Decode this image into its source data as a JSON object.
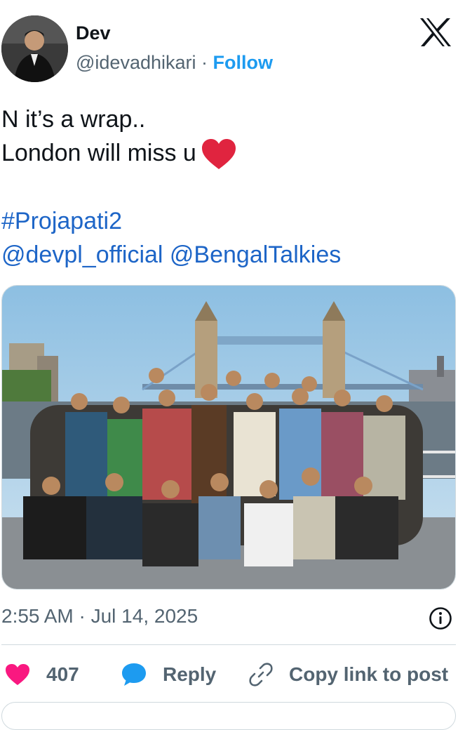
{
  "author": {
    "name": "Dev",
    "handle": "@idevadhikari",
    "separator": "·",
    "follow_label": "Follow"
  },
  "platform_icon": "x-logo-icon",
  "tweet": {
    "line1": "N it’s a wrap..",
    "line2": "London will miss u",
    "hashtag": "#Projapati2",
    "mention1": "@devpl_official",
    "mention2": "@BengalTalkies"
  },
  "meta": {
    "timestamp": "2:55 AM · Jul 14, 2025"
  },
  "actions": {
    "like_count": "407",
    "reply_label": "Reply",
    "copy_label": "Copy link to post"
  },
  "colors": {
    "accent": "#1d9bf0",
    "link": "#1d65c7",
    "like": "#f91880",
    "secondary_text": "#536471"
  },
  "icons": [
    "heart-icon",
    "speech-bubble-icon",
    "link-icon",
    "info-icon",
    "red-heart-emoji"
  ]
}
